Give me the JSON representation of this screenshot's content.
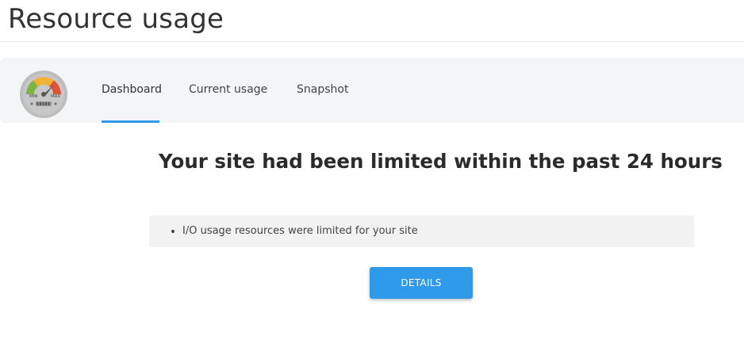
{
  "page": {
    "title": "Resource usage"
  },
  "nav": {
    "logo_icon": "gauge-icon",
    "logo_labels": {
      "min": "MIN",
      "max": "MAX"
    },
    "tabs": [
      {
        "label": "Dashboard",
        "active": true
      },
      {
        "label": "Current usage",
        "active": false
      },
      {
        "label": "Snapshot",
        "active": false
      }
    ]
  },
  "main": {
    "headline": "Your site had been limited within the past 24 hours",
    "limits": [
      "I/O usage resources were limited for your site"
    ],
    "details_button": "DETAILS"
  },
  "colors": {
    "accent": "#2e9ae9",
    "panel_background": "#f4f5f7",
    "notice_background": "#f2f2f2"
  }
}
